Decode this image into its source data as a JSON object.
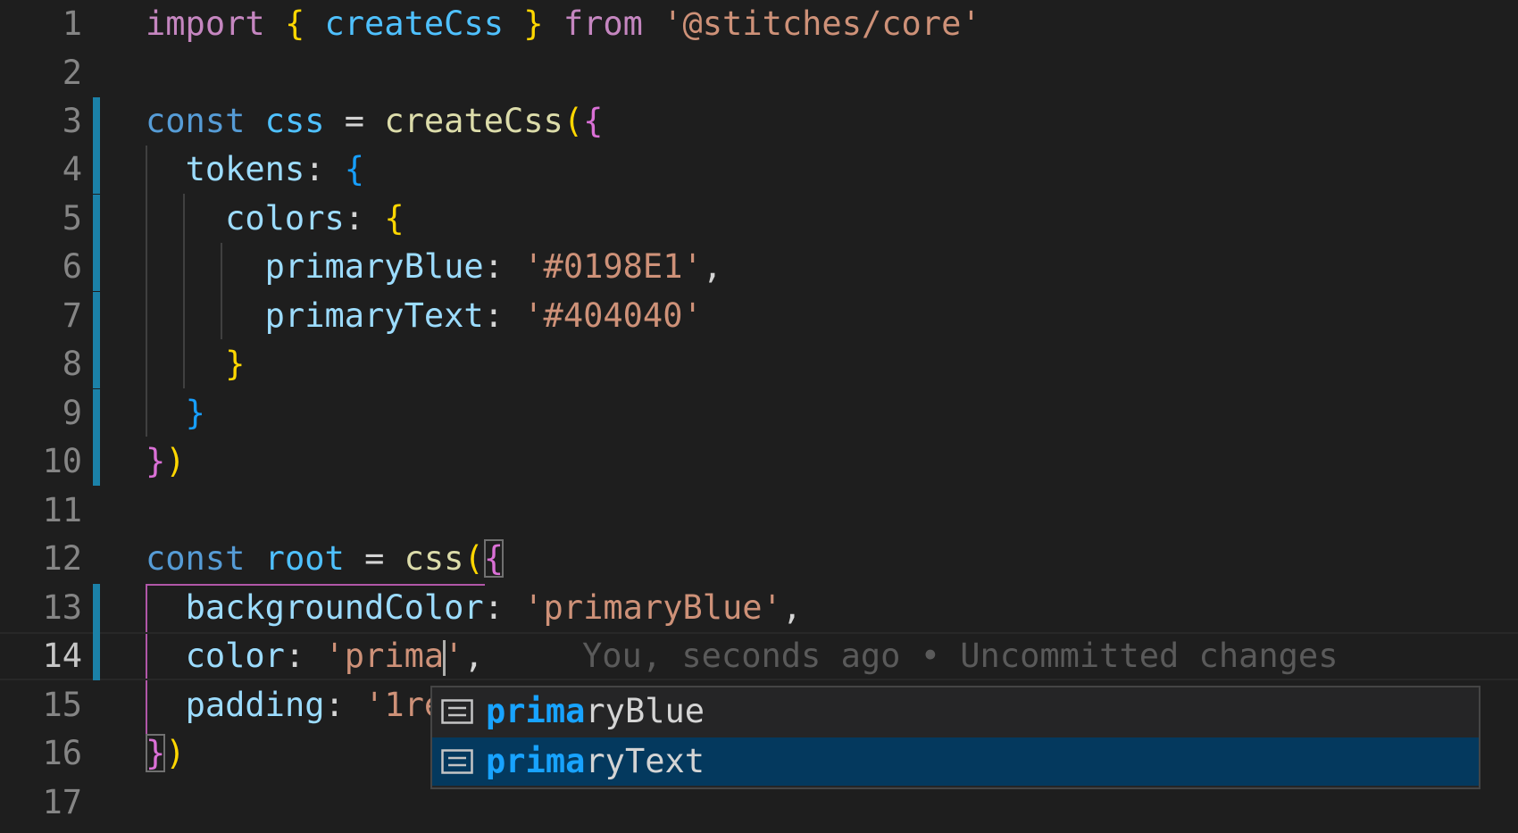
{
  "editor": {
    "language": "typescript",
    "current_line": 14,
    "lines": [
      {
        "n": "1"
      },
      {
        "n": "2"
      },
      {
        "n": "3"
      },
      {
        "n": "4"
      },
      {
        "n": "5"
      },
      {
        "n": "6"
      },
      {
        "n": "7"
      },
      {
        "n": "8"
      },
      {
        "n": "9"
      },
      {
        "n": "10"
      },
      {
        "n": "11"
      },
      {
        "n": "12"
      },
      {
        "n": "13"
      },
      {
        "n": "14"
      },
      {
        "n": "15"
      },
      {
        "n": "16"
      },
      {
        "n": "17"
      }
    ],
    "code": {
      "l1": {
        "import": "import",
        "ob": "{",
        "name": "createCss",
        "cb": "}",
        "from": "from",
        "module": "'@stitches/core'"
      },
      "l3": {
        "const": "const",
        "name": "css",
        "eq": "=",
        "fn": "createCss",
        "paren": "(",
        "ob": "{"
      },
      "l4": {
        "prop": "tokens",
        "colon": ":",
        "ob": "{"
      },
      "l5": {
        "prop": "colors",
        "colon": ":",
        "ob": "{"
      },
      "l6": {
        "prop": "primaryBlue",
        "colon": ":",
        "value": "'#0198E1'",
        "comma": ","
      },
      "l7": {
        "prop": "primaryText",
        "colon": ":",
        "value": "'#404040'"
      },
      "l8": {
        "cb": "}"
      },
      "l9": {
        "cb": "}"
      },
      "l10": {
        "cb": "}",
        "paren": ")"
      },
      "l12": {
        "const": "const",
        "name": "root",
        "eq": "=",
        "fn": "css",
        "paren": "(",
        "ob": "{"
      },
      "l13": {
        "prop": "backgroundColor",
        "colon": ":",
        "value": "'primaryBlue'",
        "comma": ","
      },
      "l14": {
        "prop": "color",
        "colon": ":",
        "value_before_cursor": "'prima",
        "value_after_cursor": "'",
        "comma": ","
      },
      "l15": {
        "prop": "padding",
        "colon": ":",
        "value": "'1re"
      },
      "l16": {
        "cb": "}",
        "paren": ")"
      }
    },
    "blame_hint": "You, seconds ago • Uncommitted changes"
  },
  "suggest": {
    "items": [
      {
        "match": "prima",
        "rest": "ryBlue",
        "kind": "property-icon",
        "selected": false
      },
      {
        "match": "prima",
        "rest": "ryText",
        "kind": "property-icon",
        "selected": true
      }
    ]
  },
  "colors": {
    "background": "#1e1e1e",
    "keyword": "#c586c0",
    "declaration": "#569cd6",
    "variable": "#4fc1ff",
    "function": "#dcdcaa",
    "property": "#9cdcfe",
    "string": "#ce9178",
    "git_modified": "#1b81a8",
    "suggest_selected": "#04395e",
    "match_highlight": "#18a3ff"
  }
}
